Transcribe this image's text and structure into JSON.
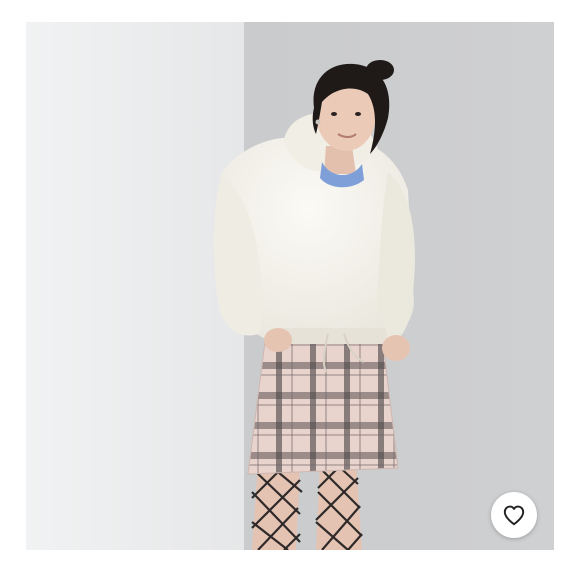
{
  "listing": {
    "photo": {
      "subject": "model-in-white-sherpa-hoodie-and-plaid-mini-skirt",
      "background_left": "#eeeff0",
      "background_right": "#c9cacc",
      "hoodie_color": "#f3f1ea",
      "skirt_base_color": "#e8d2cc",
      "skirt_plaid_color": "#4a4446",
      "tights_color": "#1c1a1b"
    },
    "like_button": {
      "icon": "heart-outline-icon",
      "color": "#222222"
    }
  }
}
